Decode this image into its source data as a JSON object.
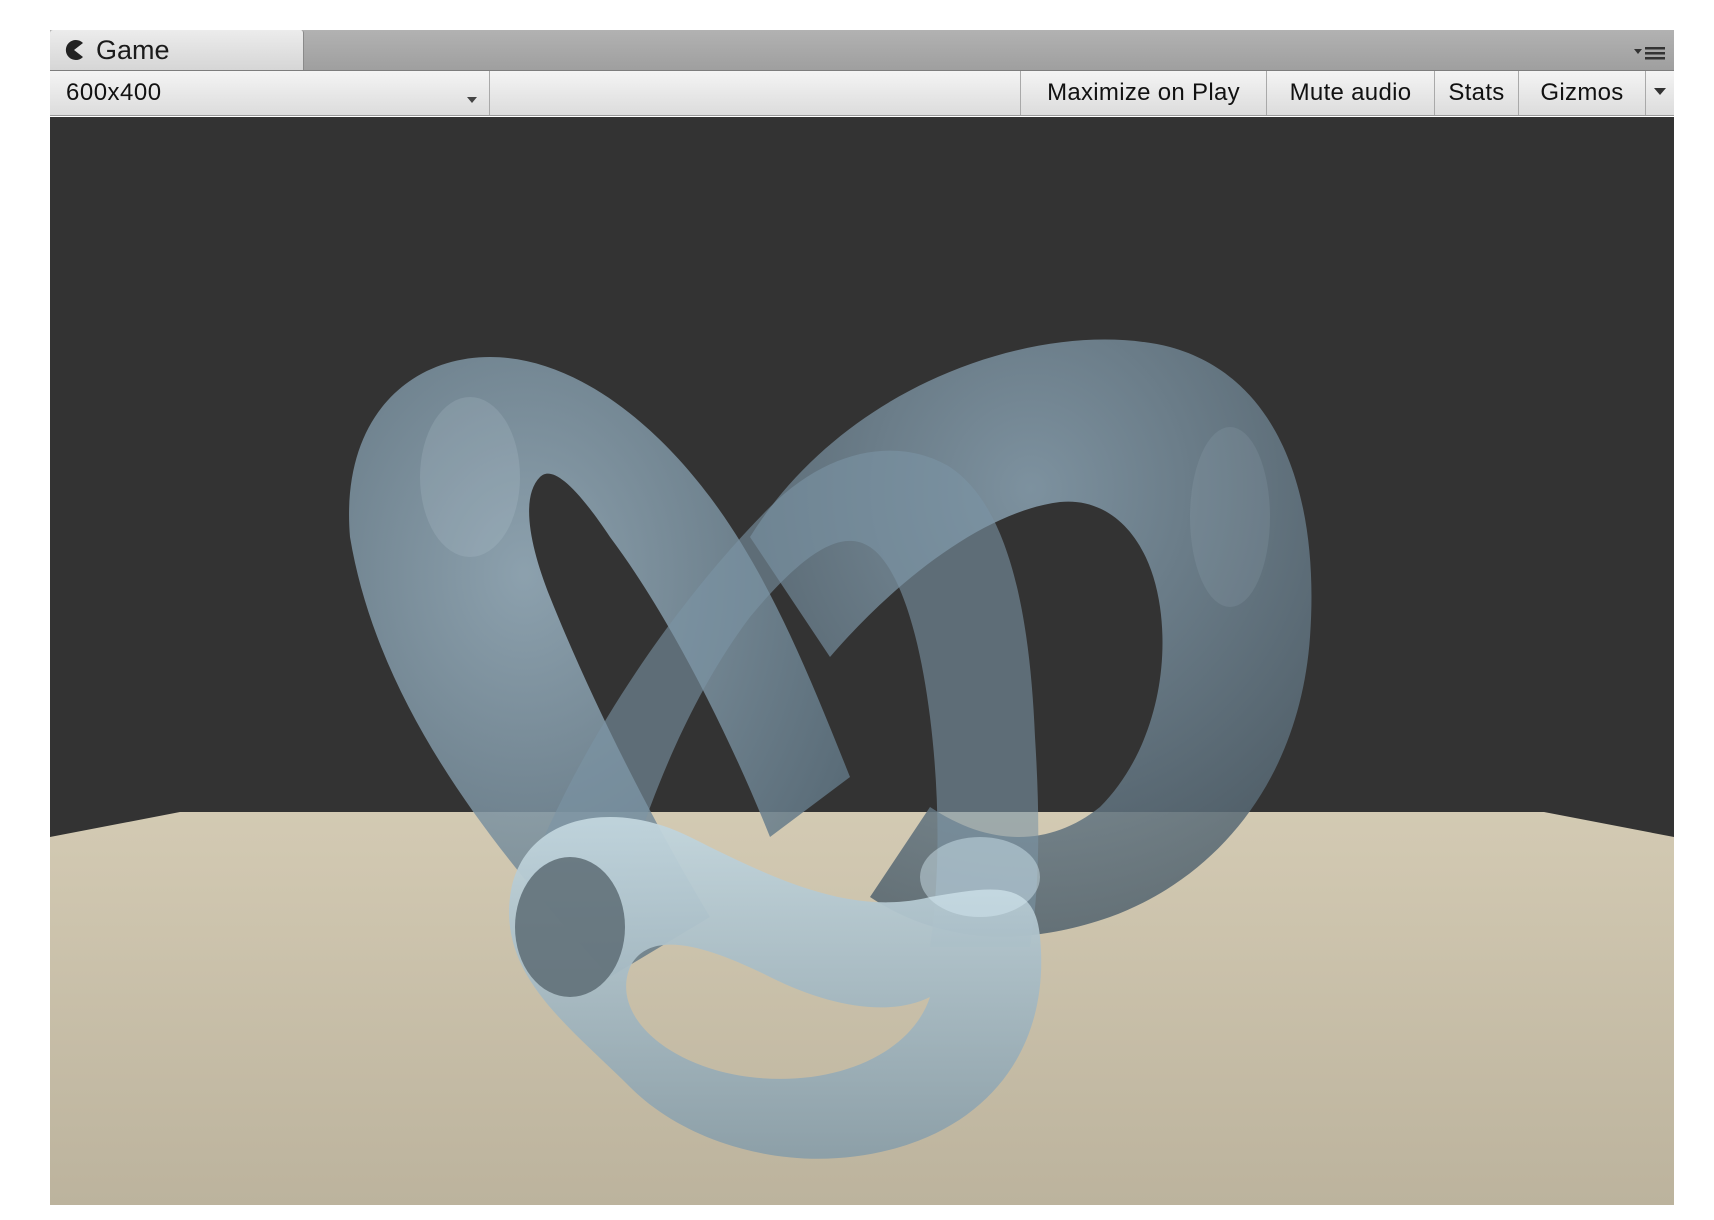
{
  "tab": {
    "label": "Game",
    "icon": "pacman-game-icon"
  },
  "toolbar": {
    "resolution": "600x400",
    "maximize_label": "Maximize on Play",
    "mute_label": "Mute audio",
    "stats_label": "Stats",
    "gizmos_label": "Gizmos"
  },
  "scene": {
    "background_color": "#333333",
    "floor_color": "#c9bfa8",
    "object_color": "#8aa4b4",
    "object": "translucent-torus-knot"
  }
}
